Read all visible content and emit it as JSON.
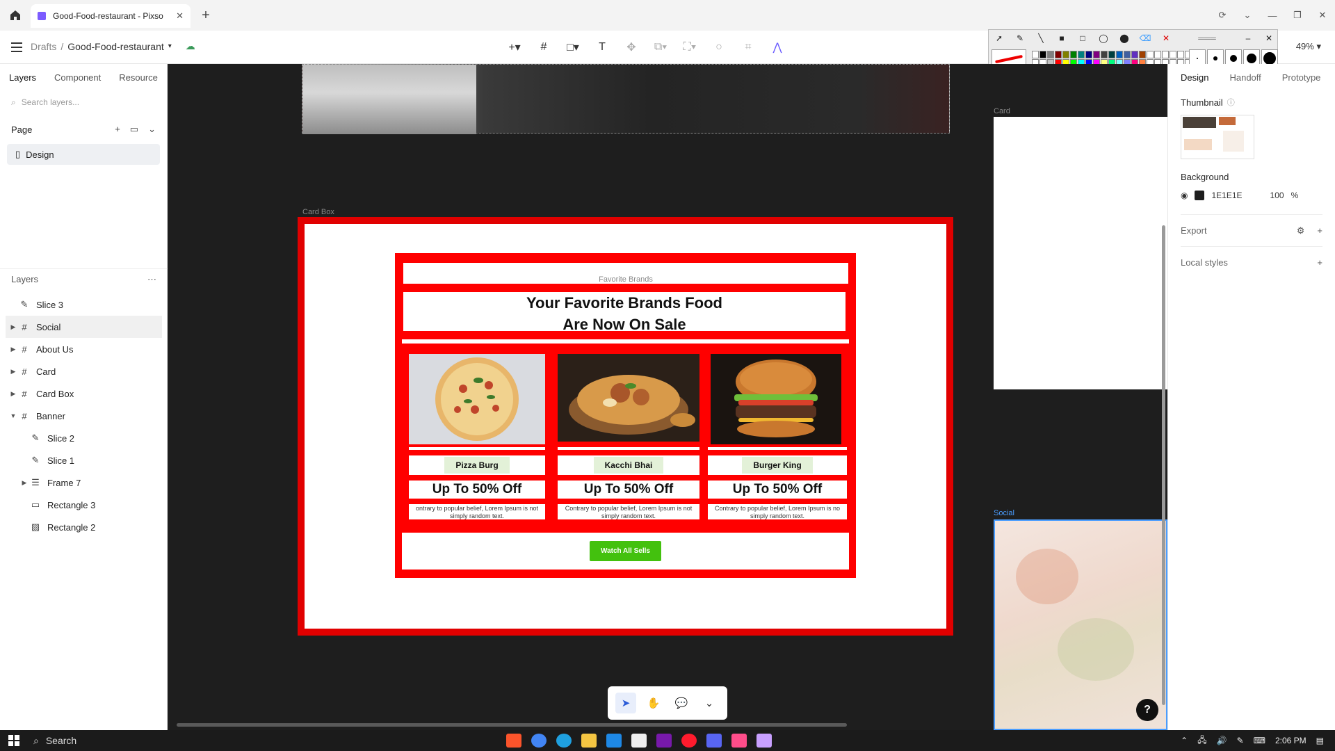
{
  "browser": {
    "tab_title": "Good-Food-restaurant - Pixso",
    "new_tab": "+"
  },
  "toolbar": {
    "breadcrumb_root": "Drafts",
    "breadcrumb_sep": "/",
    "file_name": "Good-Food-restaurant",
    "zoom": "49%"
  },
  "left_panel": {
    "tabs": [
      "Layers",
      "Component",
      "Resource"
    ],
    "search_placeholder": "Search layers...",
    "page_header": "Page",
    "page_item": "Design",
    "layers_header": "Layers",
    "layers": [
      {
        "name": "Slice 3",
        "type": "slice",
        "indent": 0,
        "caret": ""
      },
      {
        "name": "Social",
        "type": "frame",
        "indent": 0,
        "caret": "▶"
      },
      {
        "name": "About Us",
        "type": "frame",
        "indent": 0,
        "caret": "▶"
      },
      {
        "name": "Card",
        "type": "frame",
        "indent": 0,
        "caret": "▶"
      },
      {
        "name": "Card Box",
        "type": "frame",
        "indent": 0,
        "caret": "▶"
      },
      {
        "name": "Banner",
        "type": "frame",
        "indent": 0,
        "caret": "▼"
      },
      {
        "name": "Slice 2",
        "type": "slice",
        "indent": 1,
        "caret": ""
      },
      {
        "name": "Slice 1",
        "type": "slice",
        "indent": 1,
        "caret": ""
      },
      {
        "name": "Frame 7",
        "type": "auto",
        "indent": 1,
        "caret": "▶"
      },
      {
        "name": "Rectangle 3",
        "type": "rect",
        "indent": 1,
        "caret": ""
      },
      {
        "name": "Rectangle 2",
        "type": "image",
        "indent": 1,
        "caret": ""
      }
    ]
  },
  "right_panel": {
    "tabs": [
      "Design",
      "Handoff",
      "Prototype"
    ],
    "thumbnail_label": "Thumbnail",
    "background_label": "Background",
    "background_hex": "1E1E1E",
    "background_opacity": "100",
    "background_pct": "%",
    "export_label": "Export",
    "local_styles_label": "Local styles"
  },
  "canvas": {
    "card_box_label": "Card Box",
    "card_label": "Card",
    "social_label": "Social",
    "favorite_brands": "Favorite Brands",
    "headline_1": "Your Favorite Brands Food",
    "headline_2": "Are Now On Sale",
    "cards": [
      {
        "name": "Pizza Burg",
        "offer": "Up To 50% Off",
        "desc": "ontrary to popular belief, Lorem Ipsum is not simply random text."
      },
      {
        "name": "Kacchi Bhai",
        "offer": "Up To 50% Off",
        "desc": "Contrary to popular belief, Lorem Ipsum is not simply random text."
      },
      {
        "name": "Burger King",
        "offer": "Up To 50% Off",
        "desc": "Contrary to popular belief, Lorem Ipsum is no simply random text."
      }
    ],
    "button_label": "Watch All Sells"
  },
  "help_label": "?",
  "taskbar": {
    "search_label": "Search",
    "time": "2:06 PM"
  },
  "colors": {
    "canvas_bg": "#1E1E1E",
    "brand_red": "#FF0000",
    "button_green": "#43C10E",
    "name_pill": "#E3F1D8",
    "selection_blue": "#4A9DFF"
  }
}
